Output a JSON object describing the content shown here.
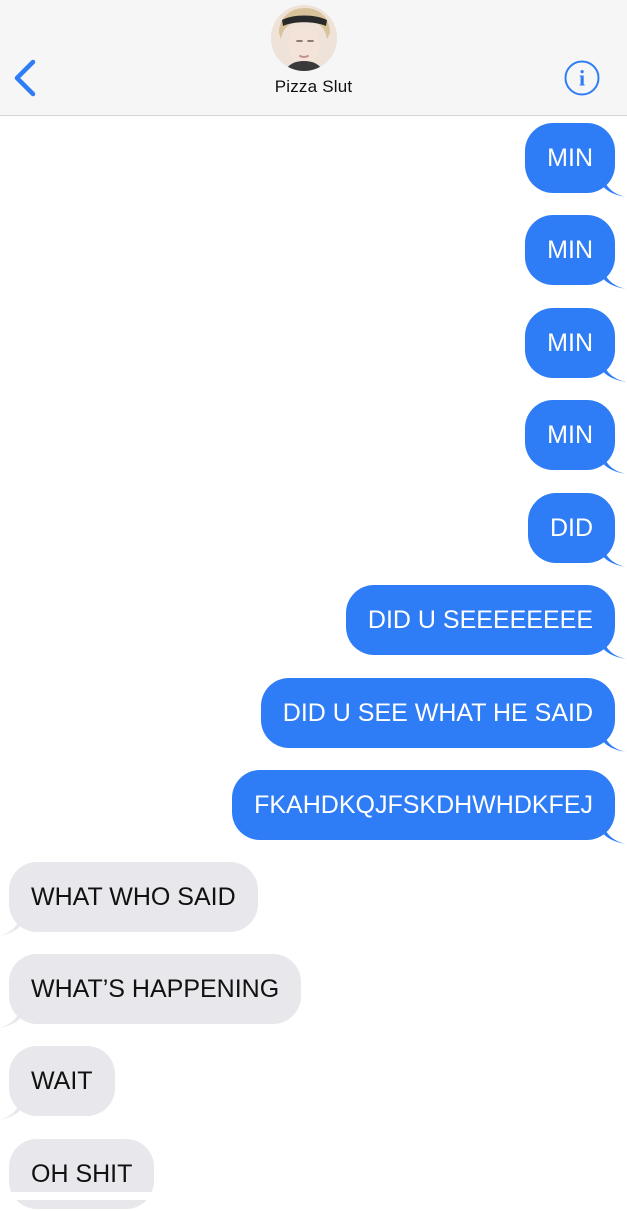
{
  "header": {
    "contact_name": "Pizza Slut",
    "back_icon": "chevron-left-icon",
    "info_icon": "info-icon",
    "accent_color": "#2f7df6"
  },
  "messages": [
    {
      "direction": "sent",
      "text": "MIN"
    },
    {
      "direction": "sent",
      "text": "MIN"
    },
    {
      "direction": "sent",
      "text": "MIN"
    },
    {
      "direction": "sent",
      "text": "MIN"
    },
    {
      "direction": "sent",
      "text": "DID"
    },
    {
      "direction": "sent",
      "text": "DID U SEEEEEEEE"
    },
    {
      "direction": "sent",
      "text": "DID U SEE WHAT HE SAID"
    },
    {
      "direction": "sent",
      "text": "FKAHDKQJFSKDHWHDKFEJ"
    },
    {
      "direction": "received",
      "text": "WHAT WHO SAID"
    },
    {
      "direction": "received",
      "text": "WHAT’S HAPPENING"
    },
    {
      "direction": "received",
      "text": "WAIT"
    },
    {
      "direction": "received",
      "text": "OH SHIT"
    }
  ],
  "colors": {
    "sent_bubble": "#2f7df6",
    "received_bubble": "#e7e7ec"
  }
}
